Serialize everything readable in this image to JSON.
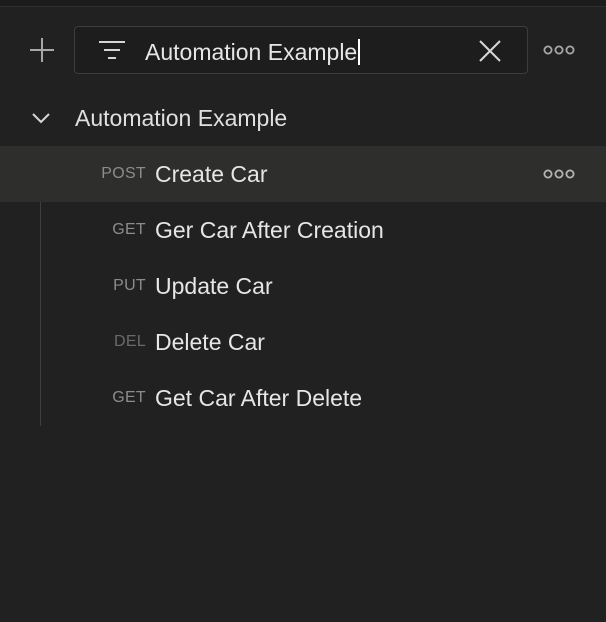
{
  "toolbar": {
    "add_icon": "plus-icon",
    "filter_icon": "filter-icon",
    "search_value": "Automation Example",
    "clear_icon": "close-icon",
    "more_icon": "more-horizontal-icon"
  },
  "collection": {
    "expand_icon": "chevron-down-icon",
    "name": "Automation Example"
  },
  "requests": [
    {
      "method": "POST",
      "name": "Create Car",
      "selected": true
    },
    {
      "method": "GET",
      "name": "Ger Car After Creation",
      "selected": false
    },
    {
      "method": "PUT",
      "name": "Update Car",
      "selected": false
    },
    {
      "method": "DEL",
      "name": "Delete Car",
      "selected": false
    },
    {
      "method": "GET",
      "name": "Get Car After Delete",
      "selected": false
    }
  ],
  "colors": {
    "background": "#212121",
    "selected_row": "#2e2e2c",
    "text": "#e6e6e6",
    "method_text": "#8c8c8c"
  }
}
